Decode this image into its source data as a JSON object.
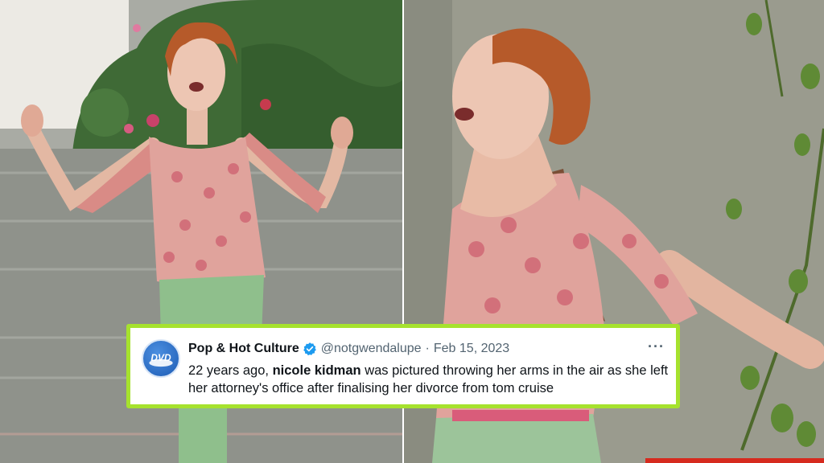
{
  "photos": {
    "left": {
      "name": "photo-left"
    },
    "right": {
      "name": "photo-right"
    }
  },
  "tweet": {
    "author_name": "Pop & Hot Culture",
    "verified": true,
    "handle": "@notgwendalupe",
    "separator": "·",
    "date": "Feb 15, 2023",
    "avatar_text": "DVD",
    "more_label": "···",
    "text_before": "22 years ago, ",
    "text_bold": "nicole kidman",
    "text_after": " was pictured throwing her arms in the air as she left her attorney's office after finalising her divorce from tom cruise"
  },
  "colors": {
    "card_border": "#a6e22e",
    "verified": "#1d9bf0",
    "text": "#0f1419",
    "muted": "#536471"
  }
}
